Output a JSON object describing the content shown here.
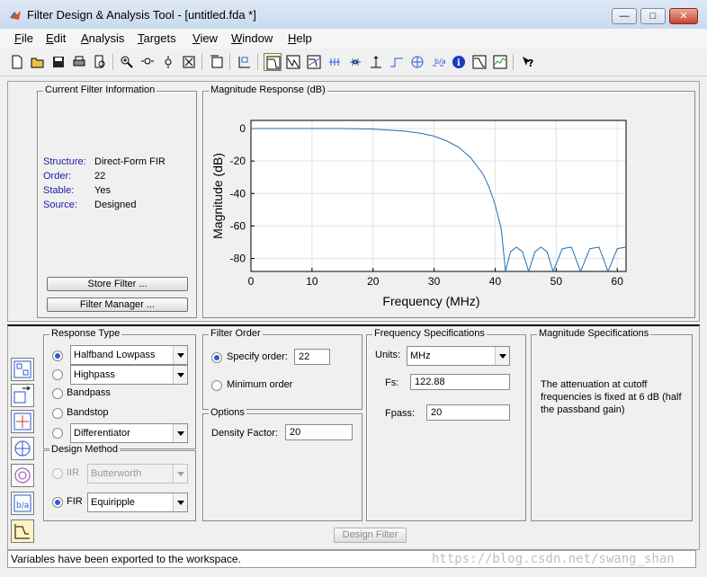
{
  "window": {
    "title": "Filter Design & Analysis Tool  -  [untitled.fda *]",
    "minimize": "—",
    "maximize": "□",
    "close": "✕"
  },
  "menu": [
    {
      "label": "File",
      "underline": "F",
      "rest": "ile"
    },
    {
      "label": "Edit",
      "underline": "E",
      "rest": "dit"
    },
    {
      "label": "Analysis",
      "underline": "A",
      "rest": "nalysis"
    },
    {
      "label": "Targets",
      "underline": "T",
      "rest": "argets"
    },
    {
      "label": "View",
      "underline": "V",
      "rest": "iew"
    },
    {
      "label": "Window",
      "underline": "W",
      "rest": "indow"
    },
    {
      "label": "Help",
      "underline": "H",
      "rest": "elp"
    }
  ],
  "toolbar_icons": [
    "new-icon",
    "open-icon",
    "save-icon",
    "print-icon",
    "print-preview-icon",
    "zoom-in-icon",
    "zoom-x-icon",
    "zoom-y-icon",
    "full-view-icon",
    "new-figure-icon",
    "legend-icon",
    "magnitude-response-icon",
    "phase-response-icon",
    "magnitude-phase-icon",
    "group-delay-icon",
    "phase-delay-icon",
    "impulse-response-icon",
    "step-response-icon",
    "pole-zero-icon",
    "filter-coefficients-icon",
    "filter-info-icon",
    "magnitude-estimate-icon",
    "round-off-noise-icon",
    "whats-this-icon"
  ],
  "current_filter": {
    "legend": "Current Filter Information",
    "structure_label": "Structure:",
    "structure_value": "Direct-Form FIR",
    "order_label": "Order:",
    "order_value": "22",
    "stable_label": "Stable:",
    "stable_value": "Yes",
    "source_label": "Source:",
    "source_value": "Designed",
    "store_button": "Store Filter ...",
    "manager_button": "Filter Manager ..."
  },
  "plot": {
    "legend": "Magnitude Response (dB)"
  },
  "chart_data": {
    "type": "line",
    "title": "",
    "xlabel": "Frequency (MHz)",
    "ylabel": "Magnitude (dB)",
    "xlim": [
      0,
      61.44
    ],
    "ylim": [
      -88,
      5
    ],
    "xticks": [
      0,
      10,
      20,
      30,
      40,
      50,
      60
    ],
    "yticks": [
      0,
      -20,
      -40,
      -60,
      -80
    ],
    "grid": true,
    "line_color": "#1f6fb5",
    "series": [
      {
        "x": [
          0,
          5,
          10,
          15,
          20,
          25,
          28,
          30,
          32,
          34,
          36,
          38,
          39,
          40,
          41,
          41.7,
          42.5,
          43.5,
          44.5,
          45.5,
          46.5,
          47.5,
          48.5,
          49.5,
          51,
          52.5,
          54,
          55.5,
          57,
          58.5,
          60,
          61.44
        ],
        "y": [
          0,
          0,
          0,
          0,
          -0.3,
          -1.5,
          -3,
          -4.7,
          -7.5,
          -11.5,
          -18,
          -28,
          -36,
          -47,
          -62,
          -88,
          -76,
          -73,
          -76,
          -88,
          -76,
          -73,
          -76,
          -88,
          -74,
          -73,
          -88,
          -74,
          -73,
          -88,
          -74,
          -73
        ]
      }
    ]
  },
  "response_type": {
    "legend": "Response Type",
    "options": [
      {
        "label": "Halfband Lowpass",
        "selected": true,
        "dropdown": true
      },
      {
        "label": "Highpass",
        "selected": false,
        "dropdown": true
      },
      {
        "label": "Bandpass",
        "selected": false,
        "dropdown": false
      },
      {
        "label": "Bandstop",
        "selected": false,
        "dropdown": false
      },
      {
        "label": "Differentiator",
        "selected": false,
        "dropdown": true
      }
    ]
  },
  "design_method": {
    "legend": "Design Method",
    "iir_label": "IIR",
    "iir_value": "Butterworth",
    "fir_label": "FIR",
    "fir_value": "Equiripple"
  },
  "filter_order": {
    "legend": "Filter Order",
    "specify_label": "Specify order:",
    "specify_value": "22",
    "minimum_label": "Minimum order"
  },
  "options": {
    "legend": "Options",
    "density_label": "Density Factor:",
    "density_value": "20"
  },
  "freq_spec": {
    "legend": "Frequency Specifications",
    "units_label": "Units:",
    "units_value": "MHz",
    "fs_label": "Fs:",
    "fs_value": "122.88",
    "fpass_label": "Fpass:",
    "fpass_value": "20"
  },
  "mag_spec": {
    "legend": "Magnitude Specifications",
    "note": "The attenuation at cutoff frequencies is fixed at 6 dB (half the passband gain)"
  },
  "design_button": "Design Filter",
  "sidebar_icons": [
    "pole-zero-editor-icon",
    "import-filter-icon",
    "transform-filter-icon",
    "realize-model-icon",
    "multirate-icon",
    "quantize-icon",
    "design-filter-icon"
  ],
  "status": "Variables have been exported to the workspace.",
  "watermark": "https://blog.csdn.net/swang_shan"
}
